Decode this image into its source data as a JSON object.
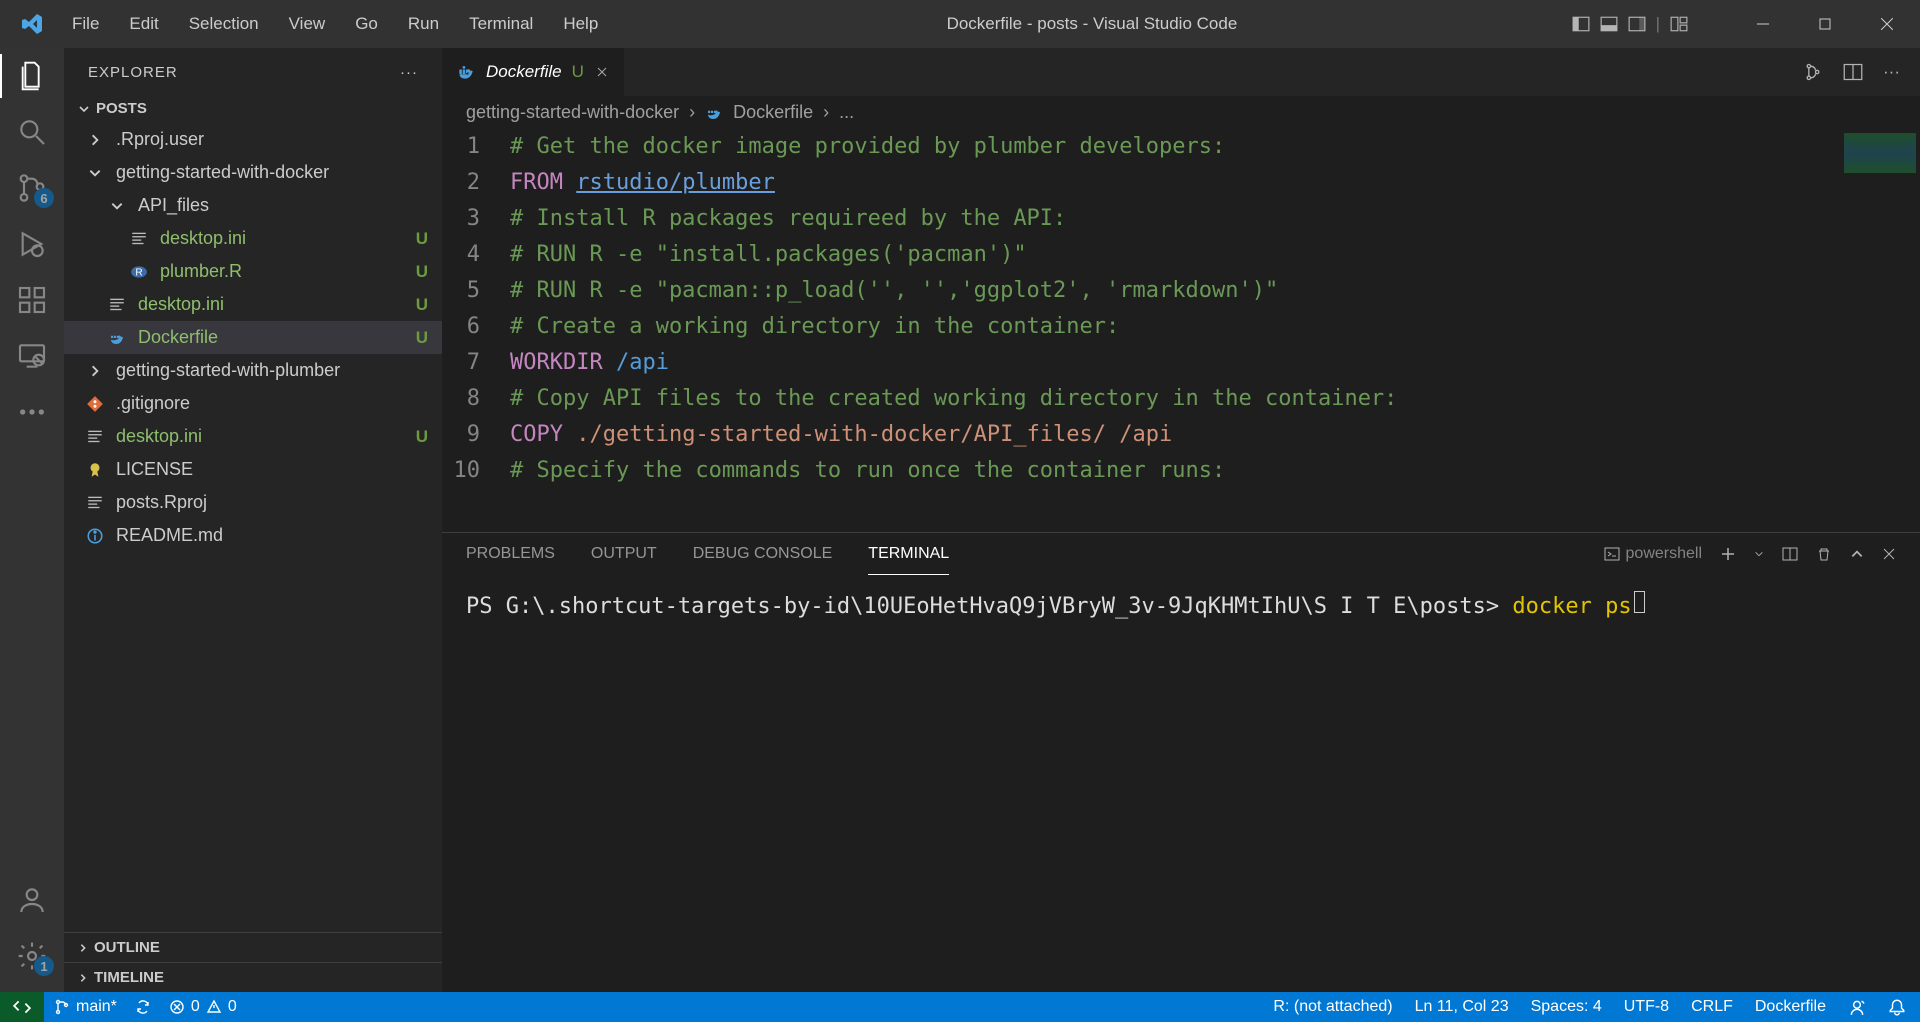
{
  "menu": [
    "File",
    "Edit",
    "Selection",
    "View",
    "Go",
    "Run",
    "Terminal",
    "Help"
  ],
  "window_title": "Dockerfile - posts - Visual Studio Code",
  "activity": {
    "scm_badge": "6",
    "settings_badge": "1"
  },
  "explorer": {
    "title": "EXPLORER",
    "root": "POSTS",
    "items": [
      {
        "indent": 0,
        "icon": "chevron-right",
        "name": ".Rproj.user",
        "status": ""
      },
      {
        "indent": 0,
        "icon": "chevron-down",
        "name": "getting-started-with-docker",
        "status": "dot"
      },
      {
        "indent": 1,
        "icon": "chevron-down",
        "name": "API_files",
        "status": "dot"
      },
      {
        "indent": 2,
        "icon": "file-lines",
        "name": "desktop.ini",
        "status": "U"
      },
      {
        "indent": 2,
        "icon": "r-file",
        "name": "plumber.R",
        "status": "U"
      },
      {
        "indent": 1,
        "icon": "file-lines",
        "name": "desktop.ini",
        "status": "U"
      },
      {
        "indent": 1,
        "icon": "docker-file",
        "name": "Dockerfile",
        "status": "U",
        "selected": true
      },
      {
        "indent": 0,
        "icon": "chevron-right",
        "name": "getting-started-with-plumber",
        "status": "dot"
      },
      {
        "indent": 0,
        "icon": "git-file",
        "name": ".gitignore",
        "status": ""
      },
      {
        "indent": 0,
        "icon": "file-lines",
        "name": "desktop.ini",
        "status": "U"
      },
      {
        "indent": 0,
        "icon": "license-file",
        "name": "LICENSE",
        "status": ""
      },
      {
        "indent": 0,
        "icon": "file-lines",
        "name": "posts.Rproj",
        "status": ""
      },
      {
        "indent": 0,
        "icon": "info-file",
        "name": "README.md",
        "status": ""
      }
    ],
    "sections": [
      "OUTLINE",
      "TIMELINE"
    ]
  },
  "tab": {
    "label": "Dockerfile",
    "modified": "U"
  },
  "breadcrumb": {
    "folder": "getting-started-with-docker",
    "file": "Dockerfile",
    "rest": "..."
  },
  "code_lines": [
    [
      {
        "t": "# Get the docker image provided by plumber developers:",
        "c": "c-comment"
      }
    ],
    [
      {
        "t": "FROM",
        "c": "c-keyword"
      },
      {
        "t": " ",
        "c": ""
      },
      {
        "t": "rstudio/plumber",
        "c": "c-link"
      }
    ],
    [
      {
        "t": "# Install R packages requireed by the API:",
        "c": "c-comment"
      }
    ],
    [
      {
        "t": "# RUN R -e \"install.packages('pacman')\"",
        "c": "c-comment"
      }
    ],
    [
      {
        "t": "# RUN R -e \"pacman::p_load('', '','ggplot2', 'rmarkdown')\"",
        "c": "c-comment"
      }
    ],
    [
      {
        "t": "# Create a working directory in the container:",
        "c": "c-comment"
      }
    ],
    [
      {
        "t": "WORKDIR",
        "c": "c-keyword"
      },
      {
        "t": " ",
        "c": ""
      },
      {
        "t": "/api",
        "c": "c-type"
      }
    ],
    [
      {
        "t": "# Copy API files to the created working directory in the container:",
        "c": "c-comment"
      }
    ],
    [
      {
        "t": "COPY",
        "c": "c-keyword"
      },
      {
        "t": " ",
        "c": ""
      },
      {
        "t": "./getting-started-with-docker/API_files/ /api",
        "c": "c-path"
      }
    ],
    [
      {
        "t": "# Specify the commands to run once the container runs:",
        "c": "c-comment"
      }
    ]
  ],
  "panel": {
    "tabs": [
      "PROBLEMS",
      "OUTPUT",
      "DEBUG CONSOLE",
      "TERMINAL"
    ],
    "active": "TERMINAL",
    "shell_name": "powershell",
    "terminal": {
      "prompt": "PS G:\\.shortcut-targets-by-id\\10UEoHetHvaQ9jVBryW_3v-9JqKHMtIhU\\S I T E\\posts> ",
      "command": "docker ps"
    }
  },
  "status": {
    "branch": "main*",
    "errors": "0",
    "warnings": "0",
    "r_status": "R: (not attached)",
    "position": "Ln 11, Col 23",
    "spaces": "Spaces: 4",
    "encoding": "UTF-8",
    "eol": "CRLF",
    "lang": "Dockerfile"
  }
}
